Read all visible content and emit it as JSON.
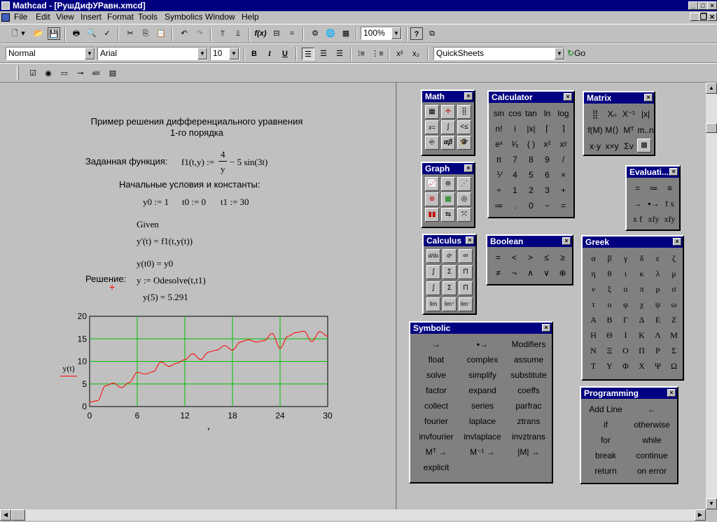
{
  "window": {
    "title": "Mathcad - [РушДифУРавн.xmcd]"
  },
  "menu": [
    "File",
    "Edit",
    "View",
    "Insert",
    "Format",
    "Tools",
    "Symbolics",
    "Window",
    "Help"
  ],
  "toolbar": {
    "zoom": "100%",
    "style": "Normal",
    "font": "Arial",
    "size": "10",
    "bold": "B",
    "italic": "I",
    "underline": "U",
    "quicksheets": "QuickSheets",
    "go": "Go",
    "sub": "x₂",
    "sup": "x²"
  },
  "worksheet": {
    "title1": "Пример решения дифференциального уравнения",
    "title2": "1-го порядка",
    "func_label": "Заданная функция:",
    "func_lhs": "f1(t,y) :=",
    "func_num": "4",
    "func_den": "y",
    "func_rhs": "− 5 sin(3t)",
    "cond_label": "Начальные условия и константы:",
    "y0": "y0 := 1",
    "t0": "t0 := 0",
    "t1": "t1 := 30",
    "given": "Given",
    "eq1": "y'(t) = f1(t,y(t))",
    "eq2": "y(t0) = y0",
    "sol_label": "Решение:",
    "solve": "y := Odesolve(t,t1)",
    "result": "y(5) = 5.291"
  },
  "chart_data": {
    "type": "line",
    "xlabel": "t",
    "ylabel": "y(t)",
    "xlim": [
      0,
      30
    ],
    "ylim": [
      0,
      20
    ],
    "xticks": [
      "0",
      "6",
      "12",
      "18",
      "24",
      "30"
    ],
    "yticks": [
      "0",
      "5",
      "10",
      "15",
      "20"
    ],
    "grid": true,
    "series": [
      {
        "color": "#ff0000",
        "x": [
          0,
          1,
          2,
          3,
          4,
          5,
          6,
          7,
          8,
          9,
          10,
          11,
          12,
          13,
          14,
          15,
          16,
          17,
          18,
          19,
          20,
          21,
          22,
          23,
          24,
          25,
          26,
          27,
          28,
          29,
          30
        ],
        "y": [
          1,
          1.3,
          4.6,
          5.2,
          4.2,
          5.3,
          7.6,
          7.2,
          7.7,
          9.9,
          8.9,
          9.6,
          10.4,
          11.7,
          10.4,
          12.1,
          12.5,
          13.5,
          12.5,
          14.3,
          14.8,
          14.3,
          14.6,
          16.2,
          12.9,
          15.6,
          16.4,
          16.7,
          14.4,
          16.6,
          15.6
        ]
      }
    ]
  },
  "palettes": {
    "math": {
      "title": "Math"
    },
    "graph": {
      "title": "Graph"
    },
    "calculus": {
      "title": "Calculus"
    },
    "calculator": {
      "title": "Calculator",
      "keys": [
        "sin",
        "cos",
        "tan",
        "ln",
        "log",
        "n!",
        "i",
        "|x|",
        "⌈",
        "⌉",
        "eˣ",
        "¹⁄ₓ",
        "( )",
        "x²",
        "xʸ",
        "π",
        "7",
        "8",
        "9",
        "/",
        "⅟",
        "4",
        "5",
        "6",
        "×",
        "÷",
        "1",
        "2",
        "3",
        "+",
        "≔",
        ".",
        "0",
        "−",
        "="
      ]
    },
    "matrix": {
      "title": "Matrix"
    },
    "evaluation": {
      "title": "Evaluati..."
    },
    "boolean": {
      "title": "Boolean",
      "keys": [
        "=",
        "<",
        ">",
        "≤",
        "≥",
        "≠",
        "¬",
        "∧",
        "∨",
        "⊕"
      ]
    },
    "greek": {
      "title": "Greek",
      "keys": [
        "α",
        "β",
        "γ",
        "δ",
        "ε",
        "ζ",
        "η",
        "θ",
        "ι",
        "κ",
        "λ",
        "μ",
        "ν",
        "ξ",
        "ο",
        "π",
        "ρ",
        "σ",
        "τ",
        "υ",
        "φ",
        "χ",
        "ψ",
        "ω",
        "Α",
        "Β",
        "Γ",
        "Δ",
        "Ε",
        "Ζ",
        "Η",
        "Θ",
        "Ι",
        "Κ",
        "Λ",
        "Μ",
        "Ν",
        "Ξ",
        "Ο",
        "Π",
        "Ρ",
        "Σ",
        "Τ",
        "Υ",
        "Φ",
        "Χ",
        "Ψ",
        "Ω"
      ]
    },
    "symbolic": {
      "title": "Symbolic",
      "keys": [
        "→",
        "▪→",
        "Modifiers",
        "float",
        "complex",
        "assume",
        "solve",
        "simplify",
        "substitute",
        "factor",
        "expand",
        "coeffs",
        "collect",
        "series",
        "parfrac",
        "fourier",
        "laplace",
        "ztrans",
        "invfourier",
        "invlaplace",
        "invztrans",
        "Mᵀ →",
        "M⁻¹ →",
        "|M| →",
        "explicit",
        "",
        ""
      ]
    },
    "programming": {
      "title": "Programming",
      "keys": [
        "Add Line",
        "←",
        "if",
        "otherwise",
        "for",
        "while",
        "break",
        "continue",
        "return",
        "on error"
      ]
    }
  }
}
